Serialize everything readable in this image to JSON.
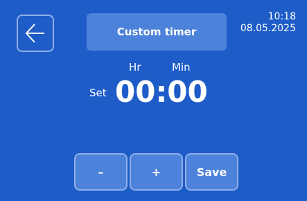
{
  "header": {
    "title": "Custom timer",
    "time": "10:18",
    "date": "08.05.2025",
    "back_icon": "arrow-left-icon"
  },
  "timer": {
    "hr_label": "Hr",
    "min_label": "Min",
    "set_label": "Set",
    "value": "00:00"
  },
  "controls": {
    "minus_label": "–",
    "plus_label": "+",
    "save_label": "Save"
  },
  "colors": {
    "background": "#1e5cc8",
    "button_fill": "#4d82da",
    "button_border": "#8fb0ea"
  }
}
